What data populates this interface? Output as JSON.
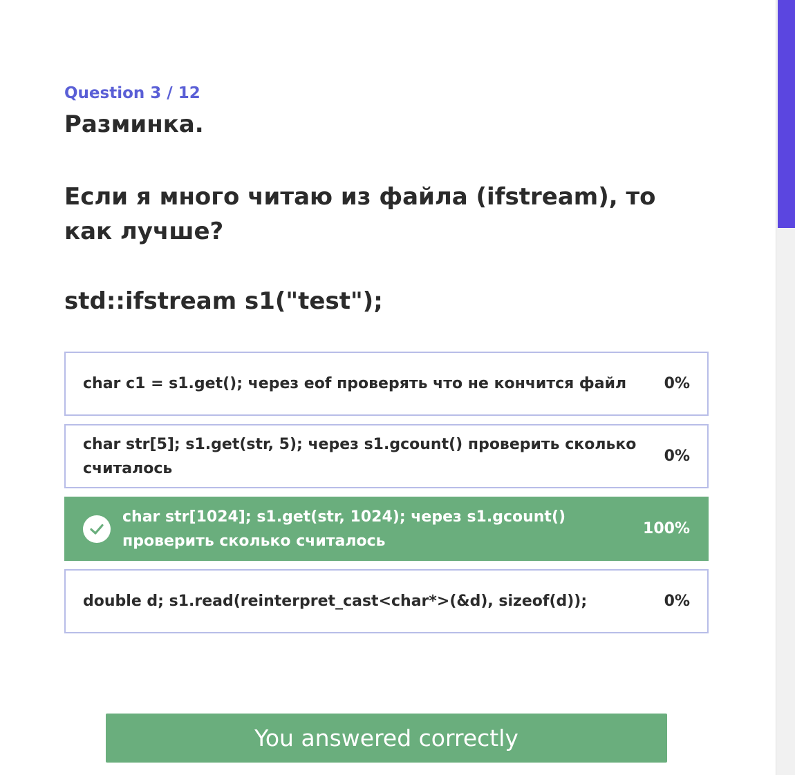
{
  "quiz": {
    "progress": "Question 3 / 12",
    "title": "Разминка.",
    "question": "Если я много читаю из файла (ifstream), то как лучше?",
    "code": "std::ifstream s1(\"test\");"
  },
  "options": [
    {
      "text": "char c1 = s1.get(); через eof проверять что не кончится файл",
      "percent": "0%",
      "correct": false
    },
    {
      "text": "char str[5]; s1.get(str, 5); через s1.gcount() проверить сколько считалось",
      "percent": "0%",
      "correct": false
    },
    {
      "text": "char str[1024]; s1.get(str, 1024); через s1.gcount() проверить сколько считалось",
      "percent": "100%",
      "correct": true,
      "icon": "checkmark-icon"
    },
    {
      "text": "double d; s1.read(reinterpret_cast<char*>(&d), sizeof(d));",
      "percent": "0%",
      "correct": false
    }
  ],
  "result": {
    "label": "You answered correctly"
  },
  "colors": {
    "accent": "#5a5fd6",
    "correct": "#6aae7d",
    "border": "#b8bde8",
    "scroll_thumb": "#5b46e0"
  }
}
